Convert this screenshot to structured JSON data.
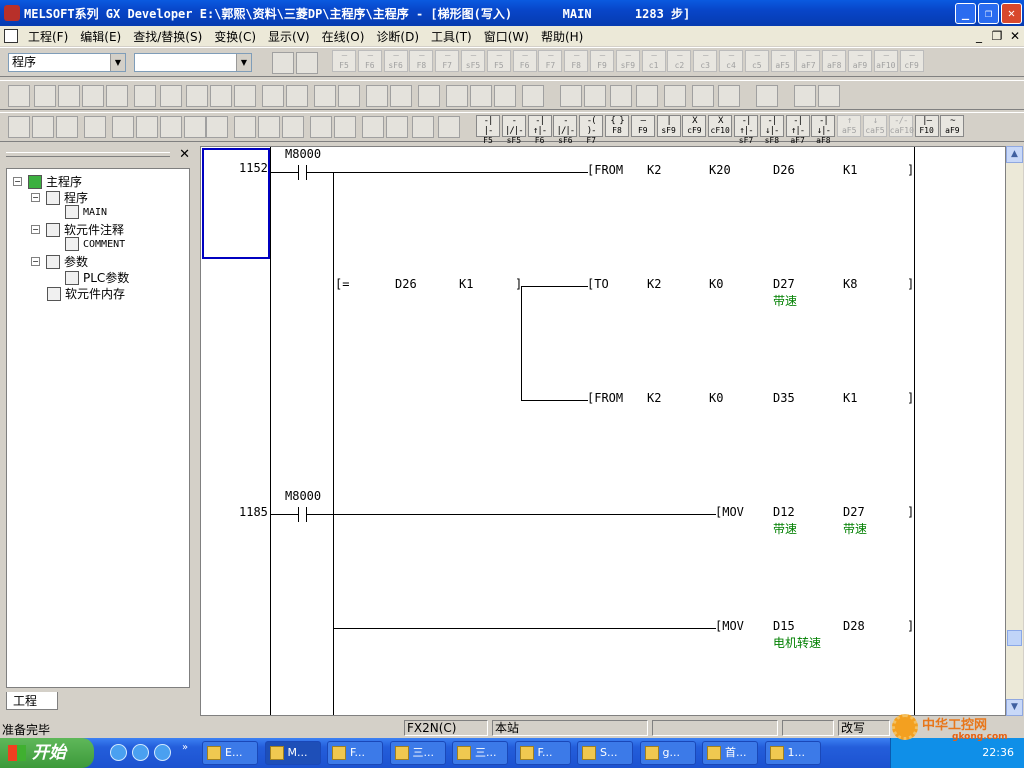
{
  "window": {
    "title": "MELSOFT系列 GX Developer E:\\郭熙\\资料\\三菱DP\\主程序\\主程序 - [梯形图(写入)       MAIN      1283 步]"
  },
  "menu": [
    "工程(F)",
    "编辑(E)",
    "查找/替换(S)",
    "变换(C)",
    "显示(V)",
    "在线(O)",
    "诊断(D)",
    "工具(T)",
    "窗口(W)",
    "帮助(H)"
  ],
  "toolbar": {
    "combo1_value": "程序",
    "combo2_value": "",
    "keys_row1": [
      [
        "—",
        "F5"
      ],
      [
        "—",
        "F6"
      ],
      [
        "—",
        "sF6"
      ],
      [
        "—",
        "F8"
      ],
      [
        "—",
        "F7"
      ],
      [
        "—",
        "sF5"
      ],
      [
        "—",
        "F5"
      ],
      [
        "—",
        "F6"
      ],
      [
        "—",
        "F7"
      ],
      [
        "—",
        "F8"
      ],
      [
        "—",
        "F9"
      ],
      [
        "—",
        "sF9"
      ],
      [
        "—",
        "c1"
      ],
      [
        "—",
        "c2"
      ],
      [
        "—",
        "c3"
      ],
      [
        "—",
        "c4"
      ],
      [
        "—",
        "c5"
      ],
      [
        "—",
        "aF5"
      ],
      [
        "—",
        "aF7"
      ],
      [
        "—",
        "aF8"
      ],
      [
        "—",
        "aF9"
      ],
      [
        "—",
        "aF10"
      ],
      [
        "—",
        "cF9"
      ]
    ],
    "keys_row3": [
      [
        "-| |-",
        "F5"
      ],
      [
        "-|/|-",
        "sF5"
      ],
      [
        "-|↑|-",
        "F6"
      ],
      [
        "-|/|-",
        "sF6"
      ],
      [
        "-( )-",
        "F7"
      ],
      [
        "{ }",
        "F8"
      ],
      [
        "—",
        "F9"
      ],
      [
        "|",
        "sF9"
      ],
      [
        "X",
        "cF9"
      ],
      [
        "X",
        "cF10"
      ],
      [
        "-|↑|-",
        "sF7"
      ],
      [
        "-|↓|-",
        "sF8"
      ],
      [
        "-|↑|-",
        "aF7"
      ],
      [
        "-|↓|-",
        "aF8"
      ],
      [
        "↑",
        "aF5"
      ],
      [
        "↓",
        "caF5"
      ],
      [
        "-/-",
        "caF10"
      ],
      [
        "|—",
        "F10"
      ],
      [
        "~",
        "aF9"
      ]
    ]
  },
  "project": {
    "panel_tab": "工程",
    "tree": [
      {
        "label": "主程序",
        "level": 0
      },
      {
        "label": "程序",
        "level": 1
      },
      {
        "label": "MAIN",
        "level": 2
      },
      {
        "label": "软元件注释",
        "level": 1
      },
      {
        "label": "COMMENT",
        "level": 2
      },
      {
        "label": "参数",
        "level": 1
      },
      {
        "label": "PLC参数",
        "level": 2
      },
      {
        "label": "软元件内存",
        "level": 1
      }
    ]
  },
  "ladder": {
    "rungs": [
      {
        "step": "1152",
        "contact": "M8000"
      },
      {
        "step": "1185",
        "contact": "M8000"
      }
    ],
    "instructions": [
      {
        "op": "FROM",
        "args": [
          "K2",
          "K20",
          "D26",
          "K1"
        ],
        "comment": ""
      },
      {
        "op": "=",
        "args": [
          "D26",
          "K1"
        ],
        "comment": ""
      },
      {
        "op": "TO",
        "args": [
          "K2",
          "K0",
          "D27",
          "K8"
        ],
        "comment": "带速"
      },
      {
        "op": "FROM",
        "args": [
          "K2",
          "K0",
          "D35",
          "K1"
        ],
        "comment": ""
      },
      {
        "op": "MOV",
        "args": [
          "D12",
          "D27"
        ],
        "comments": [
          "带速",
          "带速"
        ]
      },
      {
        "op": "MOV",
        "args": [
          "D15",
          "D28"
        ],
        "comments": [
          "电机转速",
          ""
        ]
      }
    ]
  },
  "status": {
    "ready": "准备完毕",
    "cpu": "FX2N(C)",
    "station": "本站",
    "mode": "改写"
  },
  "taskbar": {
    "start": "开始",
    "tasks": [
      "E...",
      "M...",
      "F...",
      "三...",
      "三...",
      "F...",
      "S...",
      "g...",
      "首...",
      "1..."
    ],
    "clock": "22:36"
  },
  "watermark": {
    "site": "中华工控网",
    "url": "gkong.com"
  }
}
